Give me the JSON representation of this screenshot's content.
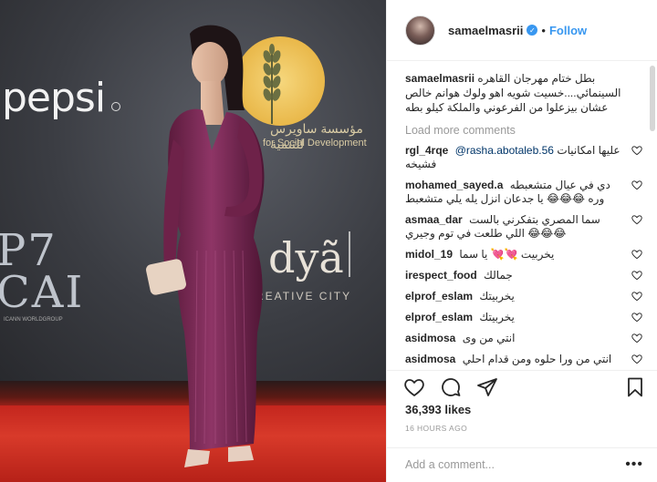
{
  "photo": {
    "sponsor_left": "pepsi",
    "sponsor_ar": "مؤسسة ساويرس للتنمية",
    "sponsor_en": "for Social Development",
    "sign_left": "P7\nCAI",
    "sign_left_sub": "ICANN WORLDGROUP",
    "brand": "dyã",
    "brand_sub": "REATIVE CITY"
  },
  "header": {
    "username": "samaelmasrii",
    "separator": "•",
    "follow_label": "Follow",
    "verified_icon": "verified-badge-icon"
  },
  "caption": {
    "username": "samaelmasrii",
    "text": "بطل ختام مهرجان القاهره السينمائي....خسيت شويه اهو ولوك هوانم خالص عشان بيزعلوا من الفرعوني والملكة كيلو بطه"
  },
  "load_more": "Load more comments",
  "comments": [
    {
      "user": "rgl_4rqe",
      "mention": "@rasha.abotaleb.56",
      "text": "عليها امكانيات فشيخه"
    },
    {
      "user": "mohamed_sayed.a",
      "text": "دي في عيال متشعبطه وره 😂😂😂 يا جدعان انزل يله يلي متشعبط"
    },
    {
      "user": "asmaa_dar",
      "text": "سما المصري بتفكرني بالست اللي طلعت في توم وجيري 😂😂😂"
    },
    {
      "user": "midol_19",
      "text": "يخربيت 💘💘 يا سما"
    },
    {
      "user": "irespect_food",
      "text": "جمالك"
    },
    {
      "user": "elprof_eslam",
      "text": "يخربيتك"
    },
    {
      "user": "elprof_eslam",
      "text": "يخربيتك"
    },
    {
      "user": "asidmosa",
      "text": "انتي من وى"
    },
    {
      "user": "asidmosa",
      "text": "انتي من ورا حلوه ومن قدام احلي"
    },
    {
      "user": "",
      "text": "........... ... ..."
    }
  ],
  "likes": "36,393 likes",
  "time_ago": "16 HOURS AGO",
  "comment_placeholder": "Add a comment...",
  "more_label": "•••",
  "colors": {
    "link_blue": "#3897f0",
    "dress": "#7b2a55",
    "carpet": "#c4261e"
  }
}
